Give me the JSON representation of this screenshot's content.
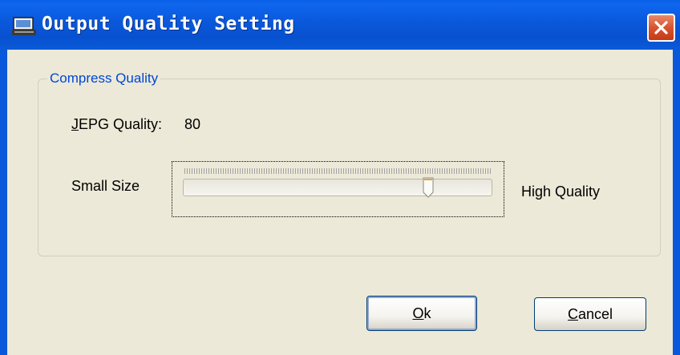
{
  "window": {
    "title": "Output Quality Setting"
  },
  "groupbox": {
    "legend": "Compress Quality"
  },
  "quality": {
    "label_mnemonic": "J",
    "label_rest": "EPG Quality:",
    "value": "80",
    "slider_min_label": "Small Size",
    "slider_max_label": "High Quality",
    "slider_level": 0.8
  },
  "buttons": {
    "ok_mnemonic": "O",
    "ok_rest": "k",
    "cancel_mnemonic": "C",
    "cancel_rest": "ancel"
  },
  "colors": {
    "title_bar": "#0a58db",
    "dialog_bg": "#ece9d8",
    "legend_text": "#0046d5",
    "close_button": "#d9542f"
  },
  "icons": {
    "app": "scanner-icon",
    "close": "close-icon"
  }
}
